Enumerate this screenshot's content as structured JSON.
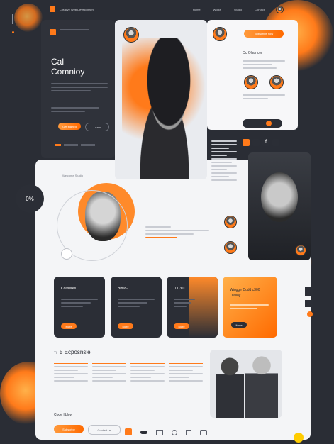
{
  "colors": {
    "accent": "#ff7a1a",
    "dark_bg": "#2a2d35",
    "panel_dark": "#2b2e36",
    "light_panel": "#f4f5f7"
  },
  "top_bar": {
    "brand": "Creative Web Development",
    "nav": [
      "Home",
      "Works",
      "Studio",
      "Contact"
    ]
  },
  "hero": {
    "title_line1": "Cal",
    "title_line2": "Comnioy",
    "button_primary": "Get started",
    "button_secondary": "Learn"
  },
  "stat": {
    "value": "0%"
  },
  "profile": {
    "header": "Oc Olacncer",
    "cta": "Subscribe now"
  },
  "section_header": "Welcome Studio",
  "cards": [
    {
      "title": "Ccaseres",
      "button": "More"
    },
    {
      "title": "Binlio-",
      "button": "More"
    },
    {
      "title": "0 1 3 0",
      "button": "More"
    },
    {
      "title": "Wingge Dodd c300",
      "subtitle": "Olailoy",
      "button": "More"
    }
  ],
  "lower": {
    "heading_prefix": "Ti",
    "heading": "5 Ecposnsle",
    "footer_title": "Code Ilblov",
    "footer_btn_primary": "Subscribe",
    "footer_btn_secondary": "Contact us"
  },
  "icons": [
    "search-icon",
    "facebook-icon",
    "twitter-icon",
    "play-icon",
    "menu-icon"
  ]
}
